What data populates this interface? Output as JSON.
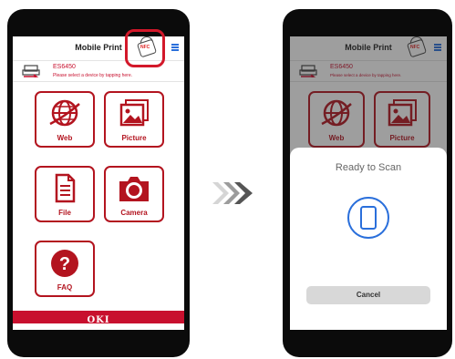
{
  "before": {
    "app_title": "Mobile Print",
    "nfc_label": "NFC",
    "device_name": "ES6450",
    "device_hint": "Please select a device by tapping here.",
    "tiles": [
      {
        "label": "Web",
        "icon": "web-globe-icon"
      },
      {
        "label": "Picture",
        "icon": "picture-icon"
      },
      {
        "label": "File",
        "icon": "file-icon"
      },
      {
        "label": "Camera",
        "icon": "camera-icon"
      },
      {
        "label": "FAQ",
        "icon": "faq-question-icon"
      }
    ],
    "brand": "OKI"
  },
  "transition_icon": "triple-chevron-right-icon",
  "after": {
    "app_title": "Mobile Print",
    "nfc_label": "NFC",
    "device_name": "ES6450",
    "device_hint": "Please select a device by tapping here.",
    "tiles": [
      {
        "label": "Web"
      },
      {
        "label": "Picture"
      }
    ],
    "scan_sheet": {
      "title": "Ready to Scan",
      "icon": "phone-scan-icon",
      "cancel_label": "Cancel"
    }
  },
  "colors": {
    "brand_red": "#c8102e",
    "highlight_red": "#d3182a",
    "scan_blue": "#2a6fdb"
  }
}
